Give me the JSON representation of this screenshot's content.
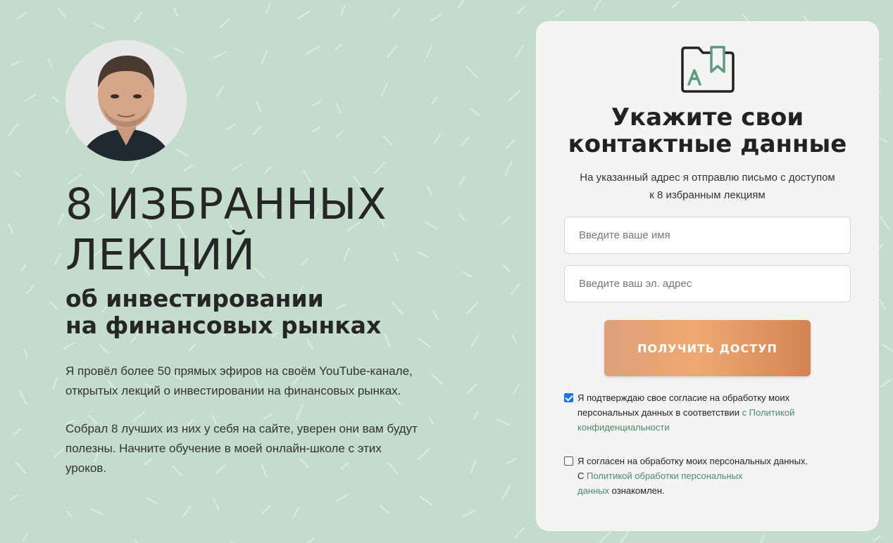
{
  "hero": {
    "headline_line1": "8 ИЗБРАННЫХ",
    "headline_line2": "ЛЕКЦИЙ",
    "sub_line1": "об инвестировании",
    "sub_line2": "на финансовых рынках",
    "para1_line1": "Я провёл более 50 прямых эфиров на своём YouTube-канале,",
    "para1_line2": "открытых лекций о инвестировании на финансовых рынках.",
    "para2_line1": "Собрал 8 лучших из них у себя на сайте, уверен они вам будут",
    "para2_line2": "полезны. Начните обучение в моей онлайн-школе с этих",
    "para2_line3": "уроков."
  },
  "form": {
    "icon": "folder-bookmark-icon",
    "title_line1": "Укажите свои",
    "title_line2": "контактные данные",
    "sub_line1": "На указанный адрес я отправлю письмо с доступом",
    "sub_line2": "к 8 избранным лекциям",
    "name_placeholder": "Введите ваше имя",
    "email_placeholder": "Введите ваш эл. адрес",
    "submit_label": "ПОЛУЧИТЬ ДОСТУП",
    "consent1": {
      "checked": true,
      "line1": "Я подтверждаю свое согласие на обработку моих",
      "line2_text": "персональных данных в соответствии ",
      "line2_link": "с Политикой",
      "line3_link": "конфиденциальности"
    },
    "consent2": {
      "checked": false,
      "line1": "Я согласен на обработку моих персональных данных.",
      "line2_text": "С ",
      "line2_link": "Политикой обработки персональных",
      "line3_link": "данных",
      "line3_text": " ознакомлен."
    }
  },
  "colors": {
    "background": "#c4dccb",
    "card": "#f4f4f4",
    "accent": "#f1a870",
    "link": "#4a8a6c",
    "icon_green": "#5a9c7c"
  }
}
